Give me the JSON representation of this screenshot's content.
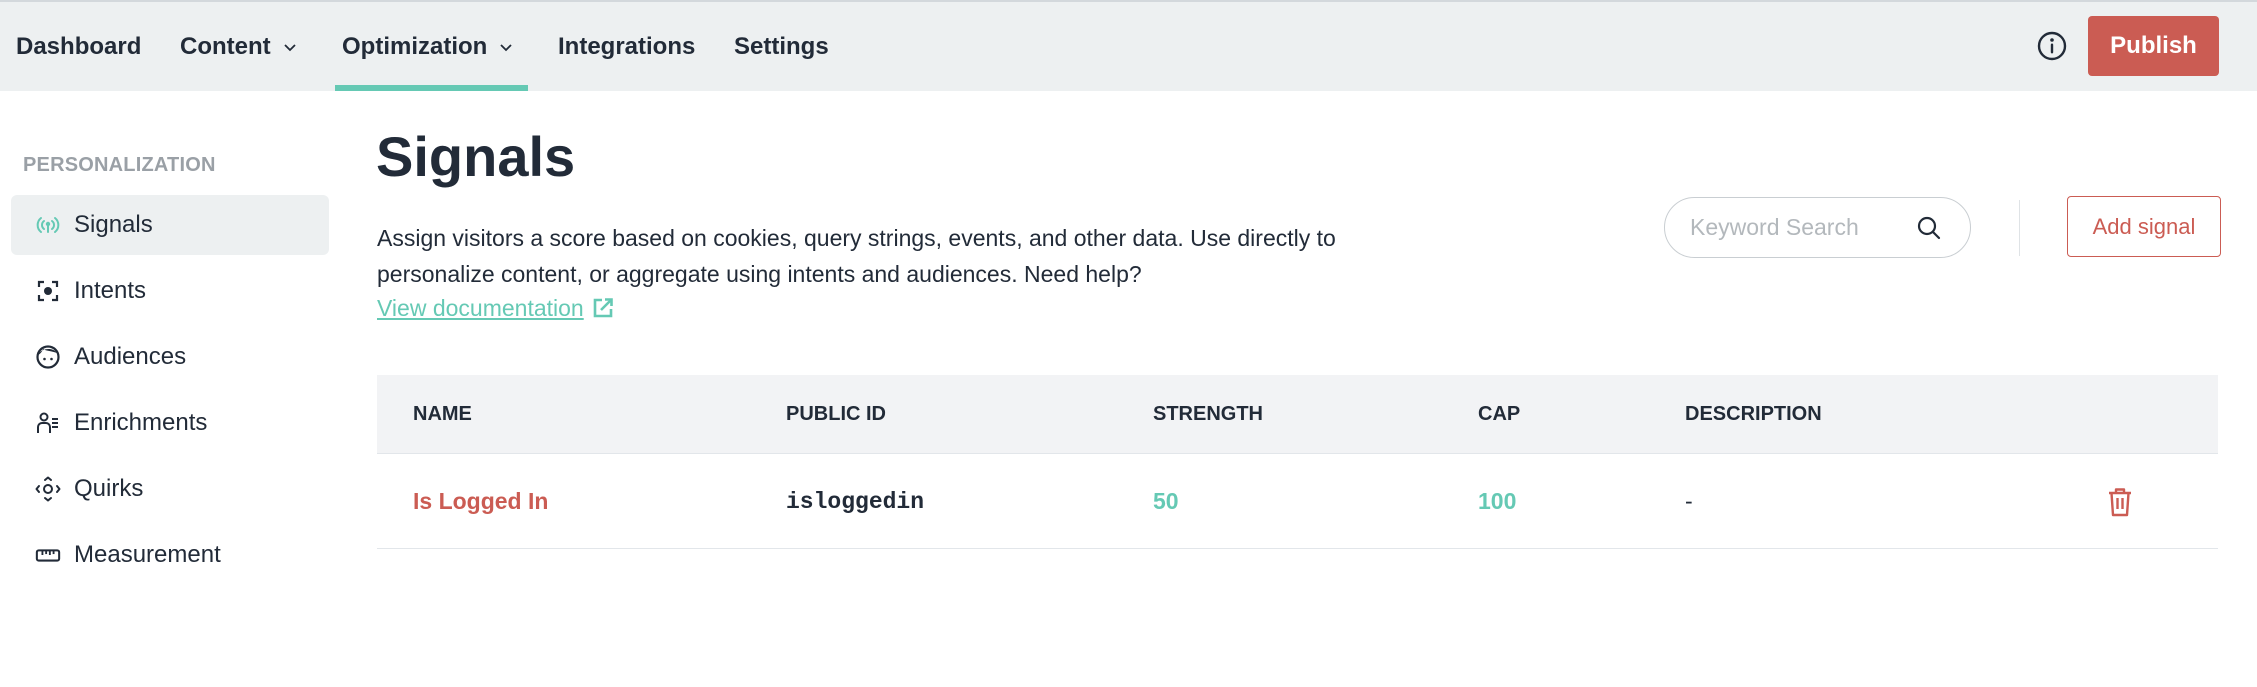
{
  "nav": {
    "items": [
      {
        "label": "Dashboard",
        "has_dropdown": false
      },
      {
        "label": "Content",
        "has_dropdown": true
      },
      {
        "label": "Optimization",
        "has_dropdown": true,
        "active": true
      },
      {
        "label": "Integrations",
        "has_dropdown": false
      },
      {
        "label": "Settings",
        "has_dropdown": false
      }
    ],
    "info_icon": "info-circle-icon",
    "publish_label": "Publish"
  },
  "colors": {
    "accent": "#65c9b4",
    "primary_action": "#cb5c53",
    "text": "#222b38",
    "header_bg": "#edf0f1"
  },
  "sidebar": {
    "section_label": "PERSONALIZATION",
    "items": [
      {
        "label": "Signals",
        "icon": "signal-broadcast-icon",
        "active": true
      },
      {
        "label": "Intents",
        "icon": "target-focus-icon"
      },
      {
        "label": "Audiences",
        "icon": "face-icon"
      },
      {
        "label": "Enrichments",
        "icon": "user-list-icon"
      },
      {
        "label": "Quirks",
        "icon": "move-arrows-icon"
      },
      {
        "label": "Measurement",
        "icon": "ruler-icon"
      }
    ]
  },
  "main": {
    "title": "Signals",
    "description": "Assign visitors a score based on cookies, query strings, events, and other data. Use directly to personalize content, or aggregate using intents and audiences. Need help?",
    "doc_link_label": "View documentation",
    "search_placeholder": "Keyword Search",
    "search_value": "",
    "add_button_label": "Add signal",
    "table": {
      "columns": [
        "NAME",
        "PUBLIC ID",
        "STRENGTH",
        "CAP",
        "DESCRIPTION"
      ],
      "rows": [
        {
          "name": "Is Logged In",
          "public_id": "isloggedin",
          "strength": "50",
          "cap": "100",
          "description": "-"
        }
      ]
    }
  }
}
